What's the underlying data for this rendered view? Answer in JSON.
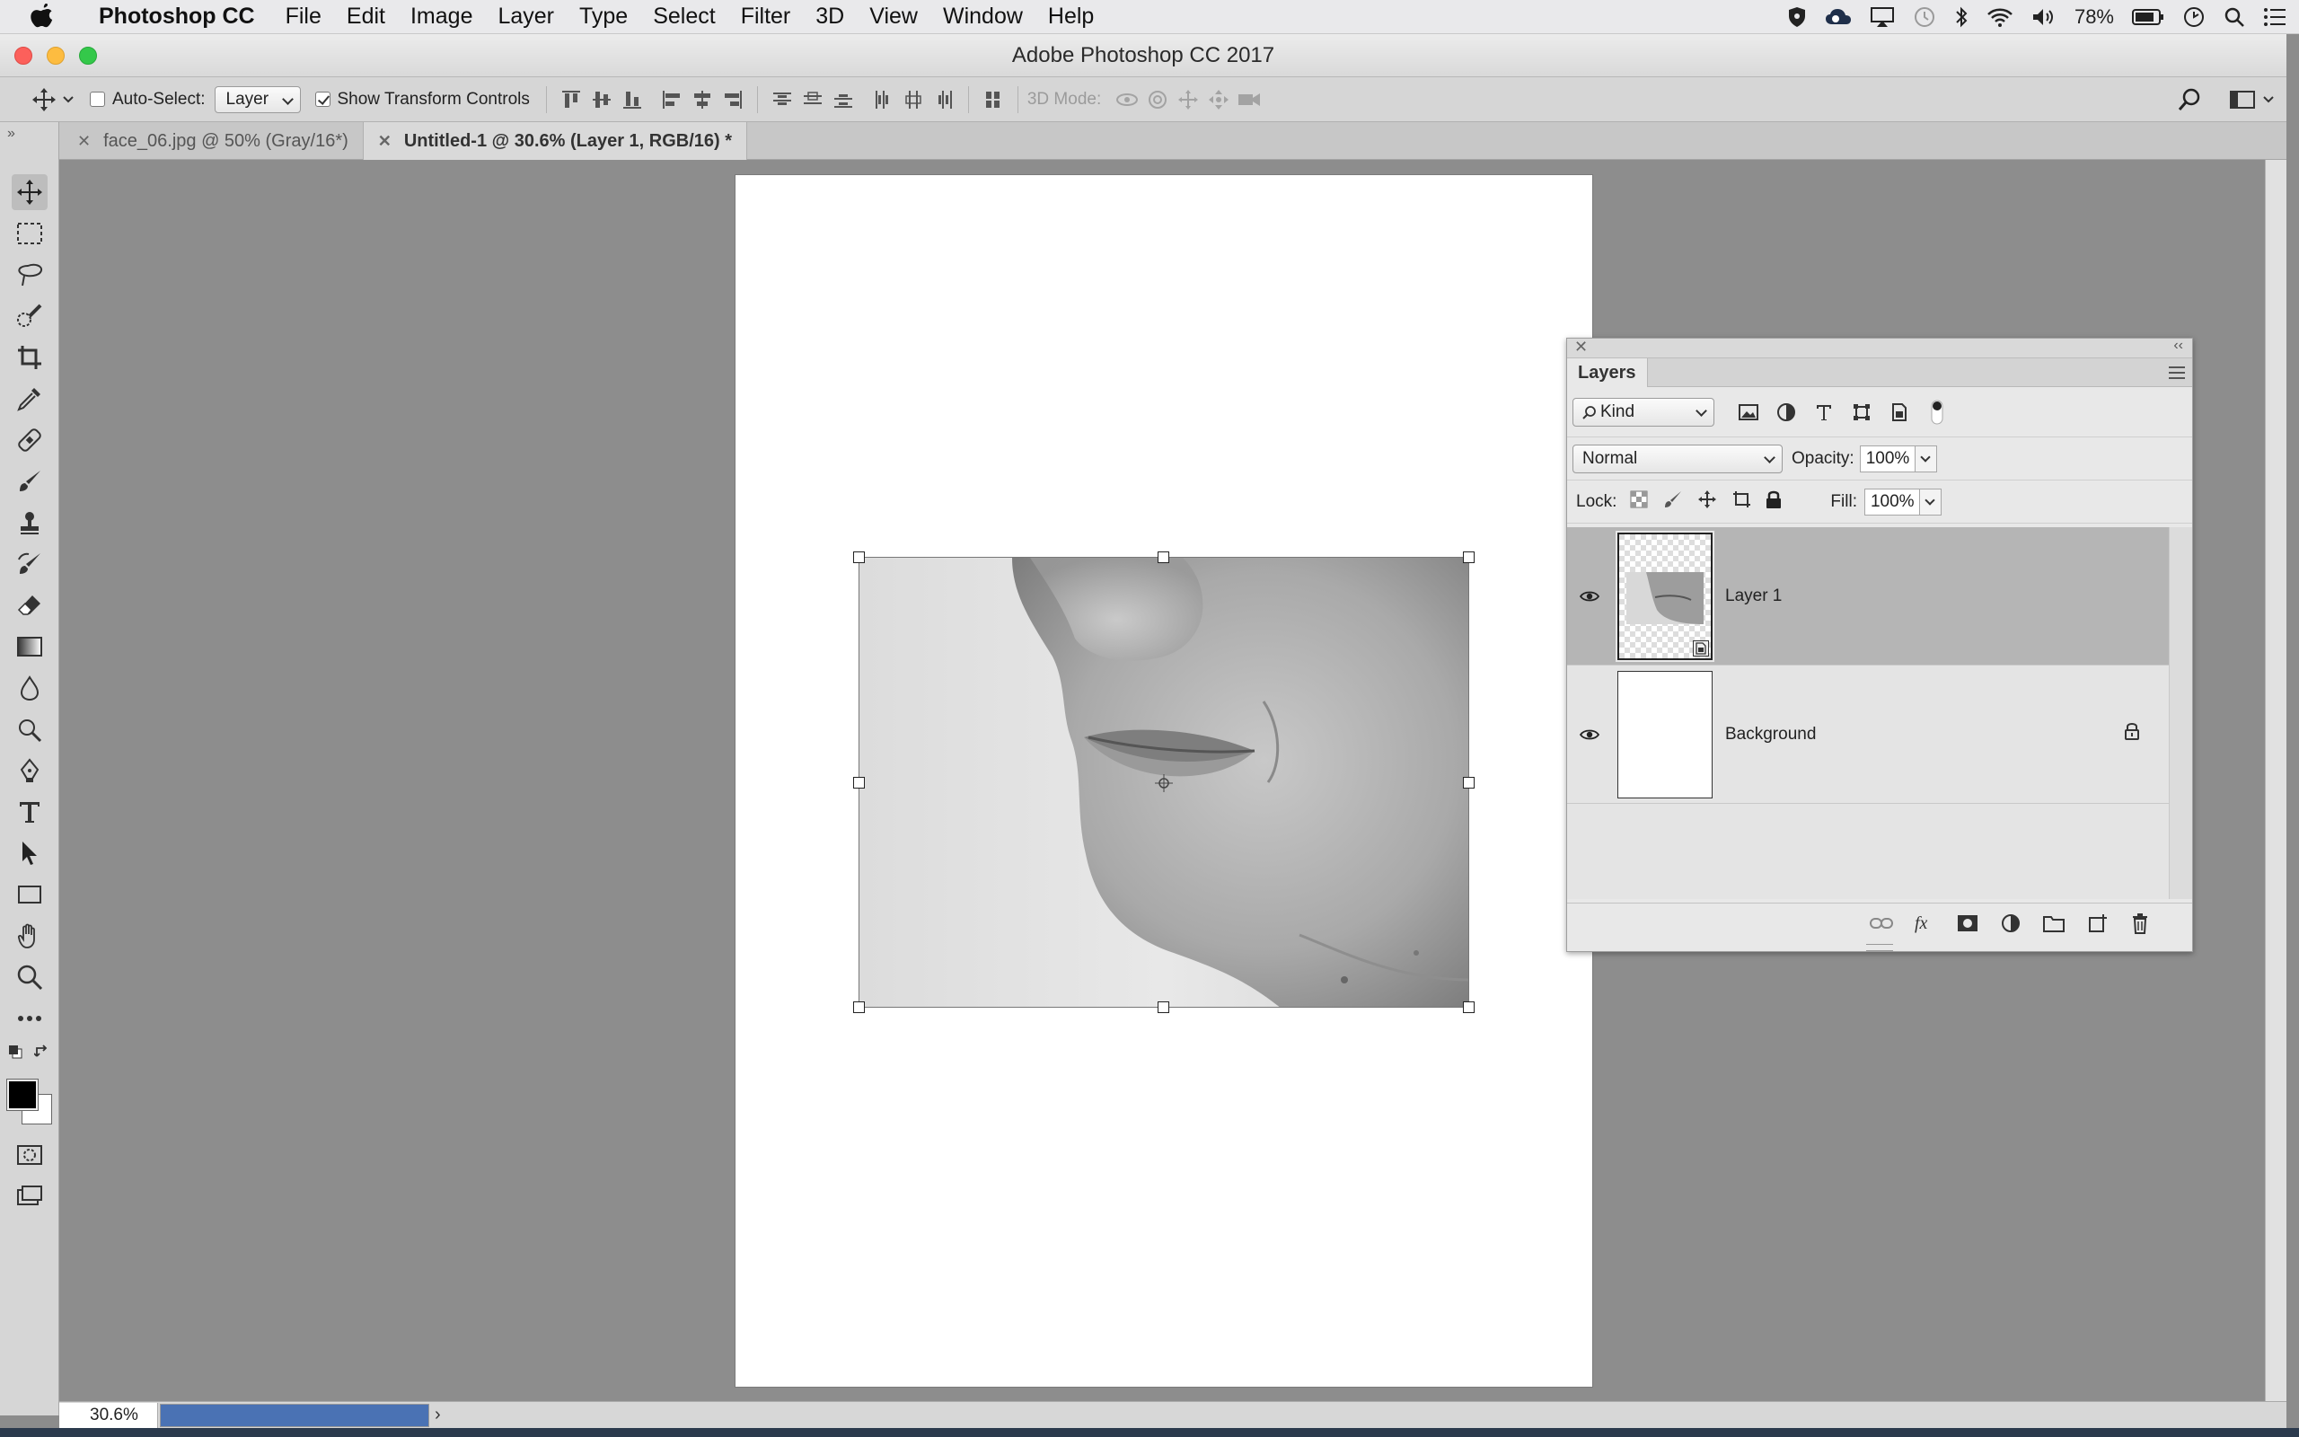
{
  "menubar": {
    "items": [
      "Photoshop CC",
      "File",
      "Edit",
      "Image",
      "Layer",
      "Type",
      "Select",
      "Filter",
      "3D",
      "View",
      "Window",
      "Help"
    ],
    "battery": "78%"
  },
  "window": {
    "title": "Adobe Photoshop CC 2017"
  },
  "options": {
    "auto_select_label": "Auto-Select:",
    "auto_select_checked": false,
    "auto_select_value": "Layer",
    "transform_label": "Show Transform Controls",
    "transform_checked": true,
    "mode_3d_label": "3D Mode:"
  },
  "tabs": [
    {
      "label": "face_06.jpg @ 50% (Gray/16*)",
      "active": false
    },
    {
      "label": "Untitled-1 @ 30.6% (Layer 1, RGB/16) *",
      "active": true
    }
  ],
  "status": {
    "zoom": "30.6%",
    "progress": 1.0
  },
  "layers_panel": {
    "tab_label": "Layers",
    "filter_kind": "Kind",
    "blend_mode": "Normal",
    "opacity_label": "Opacity:",
    "opacity_value": "100%",
    "lock_label": "Lock:",
    "fill_label": "Fill:",
    "fill_value": "100%",
    "layers": [
      {
        "name": "Layer 1",
        "visible": true,
        "selected": true,
        "locked": false
      },
      {
        "name": "Background",
        "visible": true,
        "selected": false,
        "locked": true
      }
    ]
  },
  "colors": {
    "accent_progress": "#4a72b4",
    "selected_layer": "#b5b5b5",
    "canvas_bg": "#8d8d8d"
  }
}
